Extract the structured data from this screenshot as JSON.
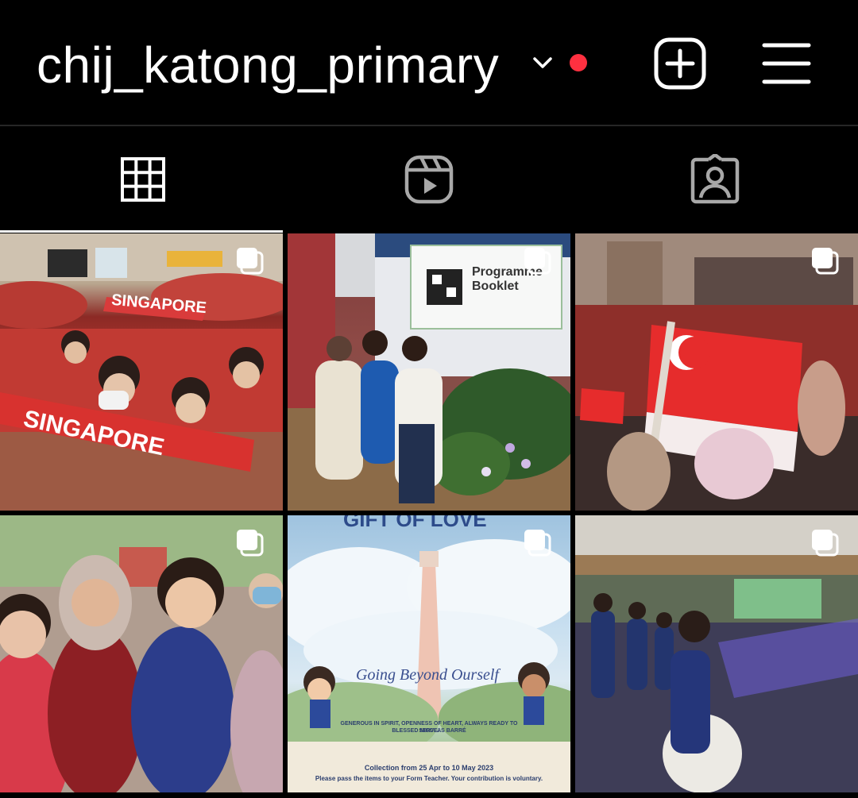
{
  "header": {
    "username": "chij_katong_primary",
    "notification_dot_color": "#ff3040",
    "icons": [
      "chevron-down-icon",
      "plus-square-icon",
      "hamburger-menu-icon"
    ]
  },
  "tabs": [
    {
      "icon": "grid-icon",
      "active": true
    },
    {
      "icon": "reels-icon",
      "active": false
    },
    {
      "icon": "tagged-icon",
      "active": false
    }
  ],
  "posts": [
    {
      "scarf_text_1": "SINGAPORE",
      "scarf_text_2": "SINGAPORE",
      "multi": true
    },
    {
      "screen_title": "Programme Booklet",
      "multi": true
    },
    {
      "multi": true
    },
    {
      "multi": true
    },
    {
      "title": "GIFT OF LOVE",
      "script_text": "Going Beyond Ourself",
      "motto": "GENEROUS IN SPIRIT, OPENNESS OF HEART, ALWAYS READY TO SERVE.",
      "motto_by": "BLESSED NICOLAS BARRÉ",
      "dates": "Collection from 25 Apr to 10 May 2023",
      "instructions": "Please pass the items to your Form Teacher. Your contribution is voluntary.",
      "multi": true
    },
    {
      "multi": true
    }
  ],
  "colors": {
    "background": "#000000",
    "text": "#ffffff",
    "divider": "#262626",
    "tab_indicator": "#ffffff",
    "inactive_icon": "#a8a8a8"
  }
}
